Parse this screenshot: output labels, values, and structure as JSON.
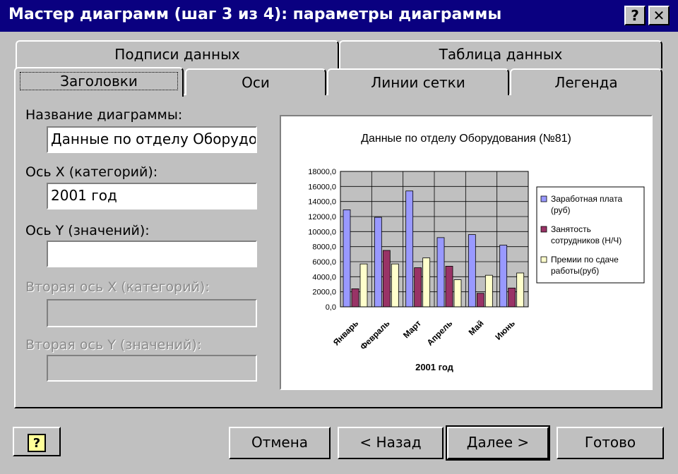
{
  "window": {
    "title": "Мастер диаграмм (шаг 3 из 4): параметры диаграммы",
    "help_button": "?",
    "close_button": "✕"
  },
  "tabs": {
    "row_back": [
      "Подписи данных",
      "Таблица данных"
    ],
    "row_front": [
      "Заголовки",
      "Оси",
      "Линии сетки",
      "Легенда"
    ],
    "active": "Заголовки"
  },
  "form": {
    "chart_title_label": "Название диаграммы:",
    "chart_title_value": "Данные по отделу Оборудо",
    "x_axis_label": "Ось X (категорий):",
    "x_axis_value": "2001 год",
    "y_axis_label": "Ось Y (значений):",
    "y_axis_value": "",
    "x2_axis_label": "Вторая ось X (категорий):",
    "x2_axis_value": "",
    "y2_axis_label": "Вторая ось Y (значений):",
    "y2_axis_value": ""
  },
  "buttons": {
    "help_icon": "?",
    "cancel": "Отмена",
    "back": "< Назад",
    "next": "Далее >",
    "finish": "Готово"
  },
  "colors": {
    "series1": "#9999ff",
    "series2": "#993366",
    "series3": "#ffffcc",
    "plot_bg": "#c0c0c0",
    "title_bar": "#0a0080"
  },
  "chart_data": {
    "type": "bar",
    "title": "Данные по отделу Оборудования (№81)",
    "xlabel": "2001 год",
    "ylabel": "",
    "categories": [
      "Январь",
      "Февраль",
      "Март",
      "Апрель",
      "Май",
      "Июнь"
    ],
    "y_ticks": [
      "0,0",
      "2000,0",
      "4000,0",
      "6000,0",
      "8000,0",
      "10000,0",
      "12000,0",
      "14000,0",
      "16000,0",
      "18000,0"
    ],
    "ylim": [
      0,
      18000
    ],
    "grid": true,
    "legend_position": "right",
    "series": [
      {
        "name": "Заработная плата (руб)",
        "values": [
          12900,
          11900,
          15400,
          9200,
          9600,
          8200
        ]
      },
      {
        "name": "Занятость сотрудников (Н/Ч)",
        "values": [
          2400,
          7500,
          5200,
          5400,
          1800,
          2500
        ]
      },
      {
        "name": "Премии по сдаче работы(руб)",
        "values": [
          5700,
          5700,
          6500,
          3600,
          4200,
          4500
        ]
      }
    ]
  }
}
